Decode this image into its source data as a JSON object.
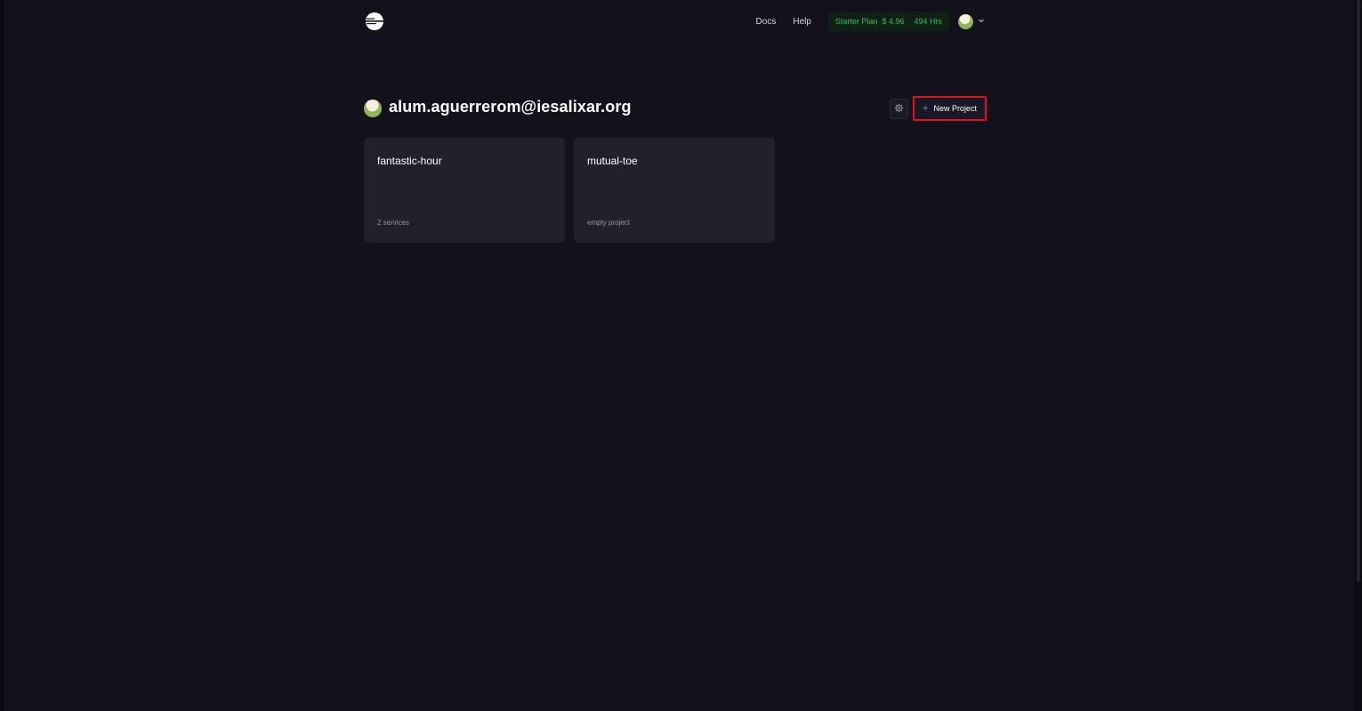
{
  "nav": {
    "logo_icon": "railway-logo-icon",
    "links": [
      "Docs",
      "Help"
    ],
    "plan": {
      "name": "Starter Plan",
      "balance": "$ 4.96",
      "hours": "494 Hrs"
    },
    "account_menu_icon": "chevron-down-icon"
  },
  "team": {
    "name": "alum.aguerrerom@iesalixar.org",
    "settings_icon": "gear-icon",
    "new_project_label": "New Project",
    "new_project_icon": "plus-icon"
  },
  "projects": [
    {
      "name": "fantastic-hour",
      "summary": "2 services"
    },
    {
      "name": "mutual-toe",
      "summary": "empty project"
    }
  ],
  "colors": {
    "background": "#13111c",
    "card": "#22202d",
    "plan_text": "#3fb65f",
    "highlight_border": "#e0101f",
    "accent": "#8a72e6"
  }
}
